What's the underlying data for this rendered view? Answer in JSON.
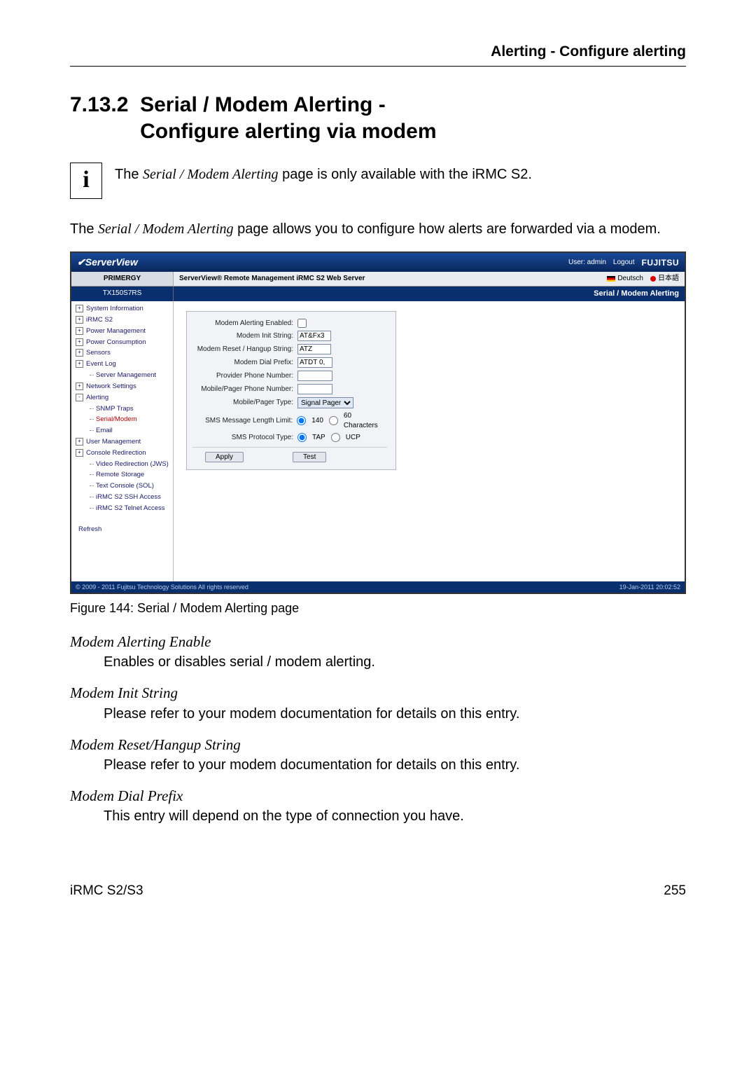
{
  "header": {
    "breadcrumb": "Alerting - Configure alerting"
  },
  "section": {
    "number": "7.13.2",
    "title_line1": "Serial / Modem Alerting -",
    "title_line2": "Configure alerting via modem"
  },
  "infobox": {
    "icon": "i",
    "prefix": "The ",
    "italic": "Serial / Modem Alerting",
    "suffix": " page is only available with the iRMC S2."
  },
  "intro": {
    "prefix": "The ",
    "italic": "Serial / Modem Alerting",
    "suffix": " page allows you to configure how alerts are forwarded via a modem."
  },
  "app": {
    "brand": "ServerView",
    "user_label": "User: admin",
    "logout": "Logout",
    "company": "FUJITSU",
    "primergy": "PRIMERGY",
    "subtitle": "ServerView® Remote Management iRMC S2 Web Server",
    "lang_de": "Deutsch",
    "lang_jp": "日本語",
    "model": "TX150S7RS",
    "page_title": "Serial / Modem Alerting",
    "footer_left": "© 2009 - 2011 Fujitsu Technology Solutions All rights reserved",
    "footer_right": "19-Jan-2011 20:02:52"
  },
  "nav": {
    "items": [
      {
        "label": "System Information",
        "type": "expand"
      },
      {
        "label": "iRMC S2",
        "type": "expand"
      },
      {
        "label": "Power Management",
        "type": "expand"
      },
      {
        "label": "Power Consumption",
        "type": "expand"
      },
      {
        "label": "Sensors",
        "type": "expand"
      },
      {
        "label": "Event Log",
        "type": "expand"
      },
      {
        "label": "Server Management",
        "type": "leaf"
      },
      {
        "label": "Network Settings",
        "type": "expand"
      },
      {
        "label": "Alerting",
        "type": "collapse"
      },
      {
        "label": "SNMP Traps",
        "type": "child"
      },
      {
        "label": "Serial/Modem",
        "type": "child",
        "active": true
      },
      {
        "label": "Email",
        "type": "child"
      },
      {
        "label": "User Management",
        "type": "expand"
      },
      {
        "label": "Console Redirection",
        "type": "expand"
      },
      {
        "label": "Video Redirection (JWS)",
        "type": "leaf"
      },
      {
        "label": "Remote Storage",
        "type": "leaf"
      },
      {
        "label": "Text Console (SOL)",
        "type": "leaf"
      },
      {
        "label": "iRMC S2 SSH Access",
        "type": "leaf"
      },
      {
        "label": "iRMC S2 Telnet Access",
        "type": "leaf"
      }
    ],
    "refresh": "Refresh"
  },
  "form": {
    "rows": {
      "enabled_label": "Modem Alerting Enabled:",
      "init_label": "Modem Init String:",
      "init_value": "AT&Fx3",
      "reset_label": "Modem Reset / Hangup String:",
      "reset_value": "ATZ",
      "dial_label": "Modem Dial Prefix:",
      "dial_value": "ATDT 0,",
      "provider_label": "Provider Phone Number:",
      "provider_value": "",
      "mobile_label": "Mobile/Pager Phone Number:",
      "mobile_value": "",
      "pager_type_label": "Mobile/Pager Type:",
      "pager_type_value": "Signal Pager",
      "sms_len_label": "SMS Message Length Limit:",
      "sms_len_opt1": "140",
      "sms_len_opt2": "60 Characters",
      "sms_proto_label": "SMS Protocol Type:",
      "sms_proto_opt1": "TAP",
      "sms_proto_opt2": "UCP"
    },
    "buttons": {
      "apply": "Apply",
      "test": "Test"
    }
  },
  "figure_caption": "Figure 144: Serial / Modem Alerting page",
  "definitions": [
    {
      "term": "Modem Alerting Enable",
      "body": "Enables or disables serial / modem alerting."
    },
    {
      "term": "Modem Init String",
      "body": "Please refer to your modem documentation for details on this entry."
    },
    {
      "term": "Modem Reset/Hangup String",
      "body": "Please refer to your modem documentation for details on this entry."
    },
    {
      "term": "Modem Dial Prefix",
      "body": "This entry will depend on the type of connection you have."
    }
  ],
  "footer": {
    "left": "iRMC S2/S3",
    "right": "255"
  }
}
